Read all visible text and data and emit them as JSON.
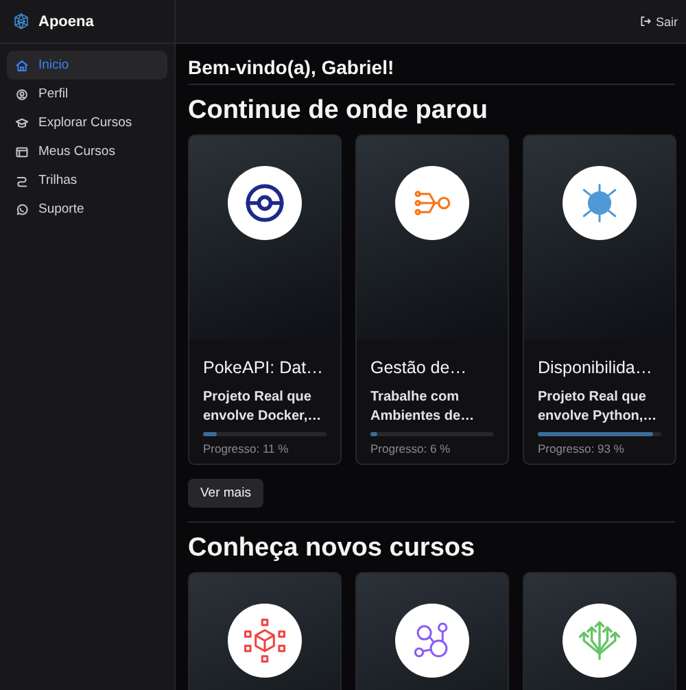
{
  "app": {
    "name": "Apoena"
  },
  "sidebar": {
    "items": [
      {
        "label": "Inicio",
        "selected": true
      },
      {
        "label": "Perfil",
        "selected": false
      },
      {
        "label": "Explorar Cursos",
        "selected": false
      },
      {
        "label": "Meus Cursos",
        "selected": false
      },
      {
        "label": "Trilhas",
        "selected": false
      },
      {
        "label": "Suporte",
        "selected": false
      }
    ]
  },
  "header": {
    "logout": "Sair"
  },
  "welcome": "Bem-vindo(a), Gabriel!",
  "continue_section": {
    "title": "Continue de onde parou",
    "courses": [
      {
        "title": "PokeAPI: Dat…",
        "description": "Projeto Real que envolve Docker,…",
        "level": 0.11,
        "progress": "Progresso: 11 %",
        "kind": "pokeball"
      },
      {
        "title": "Gestão de…",
        "description": "Trabalhe com Ambientes de…",
        "level": 0.06,
        "progress": "Progresso: 6 %",
        "kind": "flow"
      },
      {
        "title": "Disponibilida…",
        "description": "Projeto Real que envolve Python,…",
        "level": 0.93,
        "progress": "Progresso: 93 %",
        "kind": "api"
      }
    ],
    "more_button": "Ver mais"
  },
  "new_section": {
    "title": "Conheça novos cursos",
    "courses": [
      {
        "kind": "cube"
      },
      {
        "kind": "graph"
      },
      {
        "kind": "arrows"
      }
    ]
  }
}
